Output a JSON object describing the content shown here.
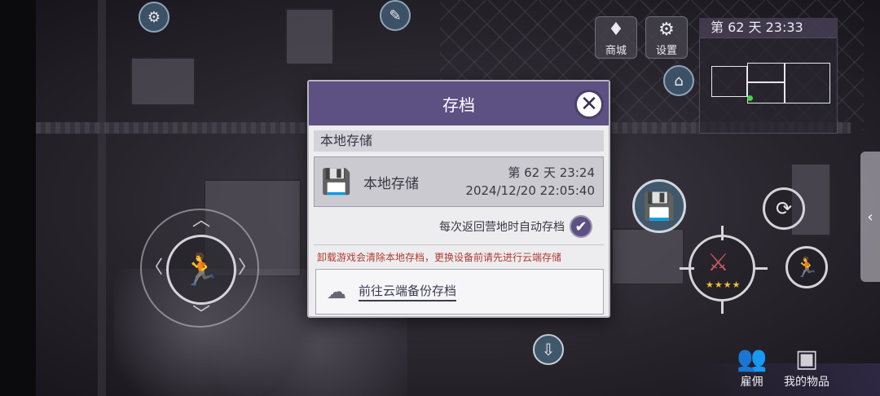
{
  "hud": {
    "shop_label": "商城",
    "shop_icon": "diamond-icon",
    "settings_label": "设置",
    "settings_icon": "gear-icon",
    "day_time": "第 62 天  23:33"
  },
  "bottom": {
    "mercenary_label": "雇佣",
    "items_label": "我的物品"
  },
  "weapon": {
    "stars": "★★★★"
  },
  "modal": {
    "title": "存档",
    "close_icon": "close-icon",
    "section_title": "本地存储",
    "local_save": {
      "label": "本地存储",
      "game_time": "第 62 天  23:24",
      "real_time": "2024/12/20 22:05:40"
    },
    "auto_save_label": "每次返回营地时自动存档",
    "auto_save_checked": true,
    "warning": "卸载游戏会清除本地存档，更换设备前请先进行云端存储",
    "cloud_link": "前往云端备份存档"
  },
  "colors": {
    "header": "#5d5083",
    "warning": "#b13a2c",
    "stars": "#f2c230"
  }
}
